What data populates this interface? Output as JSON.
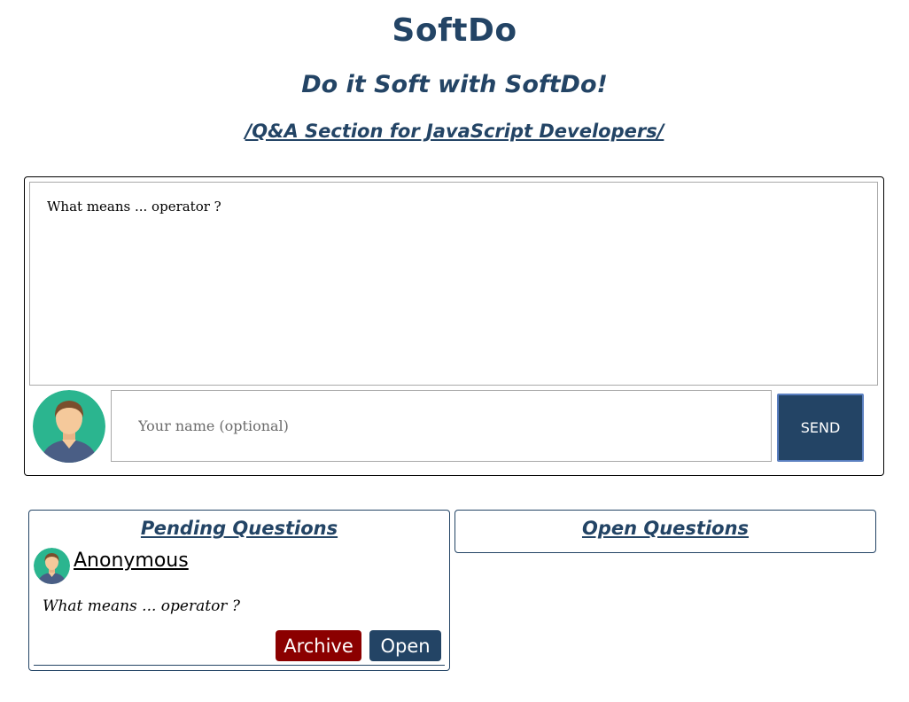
{
  "header": {
    "brand": "SoftDo",
    "tagline": "Do it Soft with SoftDo!",
    "section_link": "/Q&A Section for JavaScript Developers/"
  },
  "composer": {
    "question_value": "What means ... operator ?",
    "name_placeholder": "Your name (optional)",
    "send_label": "SEND"
  },
  "pending": {
    "title": "Pending Questions",
    "questions": [
      {
        "author": "Anonymous",
        "text": "What means ... operator ?",
        "archive_label": "Archive",
        "open_label": "Open"
      }
    ]
  },
  "open": {
    "title": "Open Questions"
  },
  "colors": {
    "brand": "#234465",
    "archive": "#8b0000",
    "avatar_bg": "#2bb58f",
    "avatar_shirt": "#4a5e85",
    "avatar_skin": "#f5c99b",
    "avatar_hair": "#7a4e2d"
  }
}
